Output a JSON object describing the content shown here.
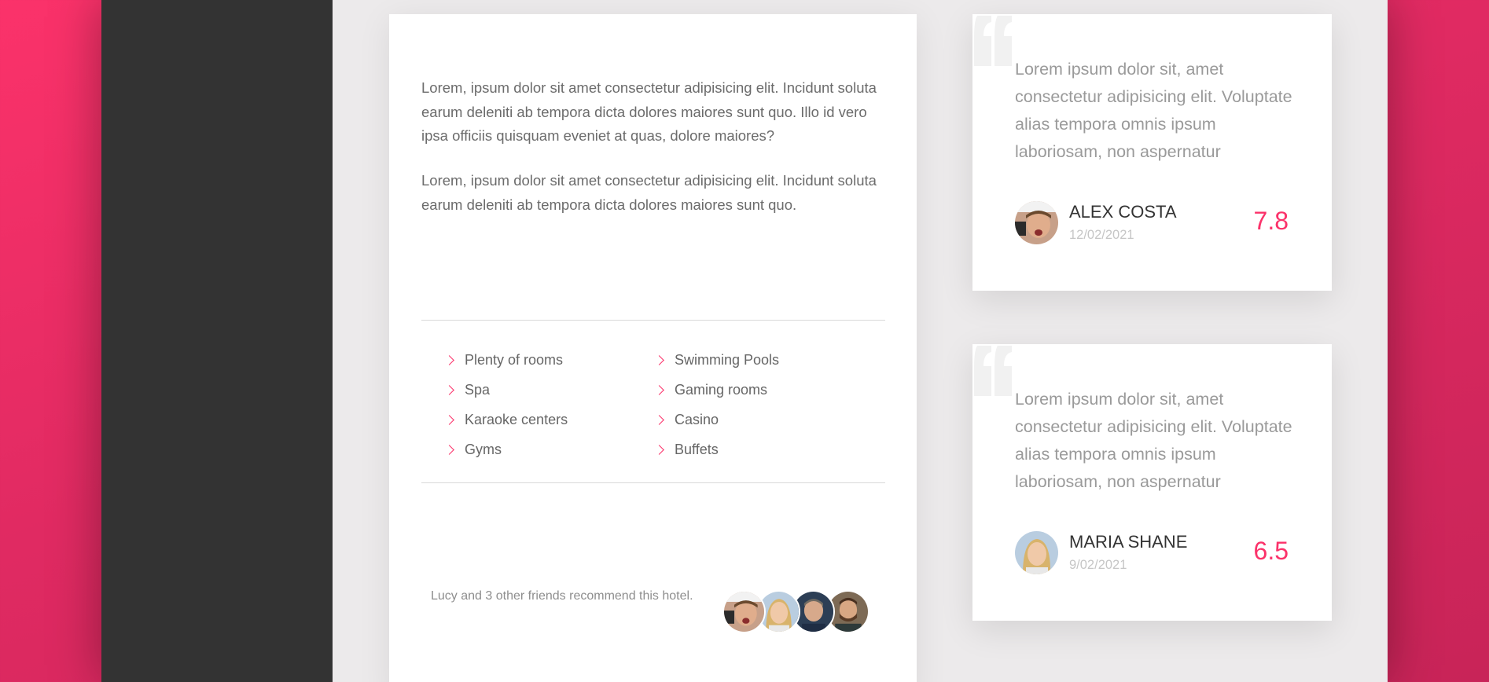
{
  "main": {
    "paragraphs": [
      "Lorem, ipsum dolor sit amet consectetur adipisicing elit. Incidunt soluta earum deleniti ab tempora dicta dolores maiores sunt quo. Illo id vero ipsa officiis quisquam eveniet at quas, dolore maiores?",
      "Lorem, ipsum dolor sit amet consectetur adipisicing elit. Incidunt soluta earum deleniti ab tempora dicta dolores maiores sunt quo."
    ],
    "amenities_left": [
      "Plenty of rooms",
      "Spa",
      "Karaoke centers",
      "Gyms"
    ],
    "amenities_right": [
      "Swimming Pools",
      "Gaming rooms",
      "Casino",
      "Buffets"
    ],
    "recommend_text": "Lucy and 3 other friends recommend this hotel.",
    "friend_avatar_count": 4
  },
  "reviews": [
    {
      "text": "Lorem ipsum dolor sit, amet consectetur adipisicing elit. Voluptate alias tempora omnis ipsum laboriosam, non aspernatur",
      "name": "ALEX COSTA",
      "date": "12/02/2021",
      "score": "7.8"
    },
    {
      "text": "Lorem ipsum dolor sit, amet consectetur adipisicing elit. Voluptate alias tempora omnis ipsum laboriosam, non aspernatur",
      "name": "MARIA SHANE",
      "date": "9/02/2021",
      "score": "6.5"
    }
  ],
  "colors": {
    "accent": "#fb326a",
    "sidebar": "#333333",
    "page_bg": "#eceaeb"
  }
}
